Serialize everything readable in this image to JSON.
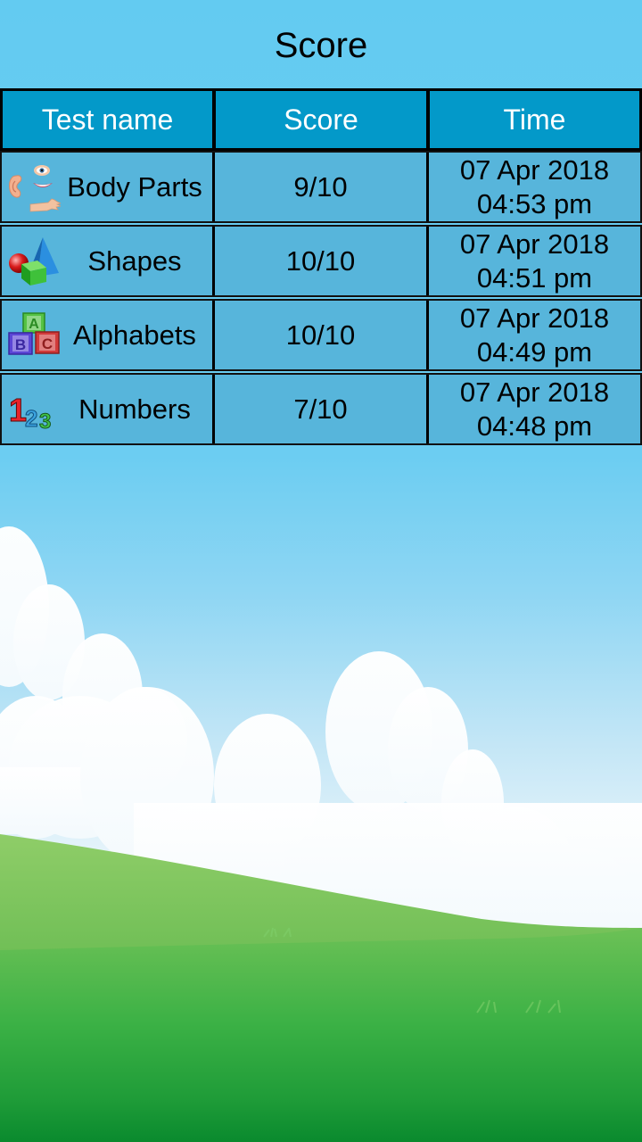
{
  "app_bar": {
    "title": "Score"
  },
  "table": {
    "headers": [
      "Test name",
      "Score",
      "Time"
    ],
    "rows": [
      {
        "icon": "body-parts-icon",
        "name": "Body Parts",
        "score": "9/10",
        "date": "07 Apr 2018",
        "time": "04:53 pm"
      },
      {
        "icon": "shapes-icon",
        "name": "Shapes",
        "score": "10/10",
        "date": "07 Apr 2018",
        "time": "04:51 pm"
      },
      {
        "icon": "alphabet-blocks-icon",
        "name": "Alphabets",
        "score": "10/10",
        "date": "07 Apr 2018",
        "time": "04:49 pm"
      },
      {
        "icon": "numbers-123-icon",
        "name": "Numbers",
        "score": "7/10",
        "date": "07 Apr 2018",
        "time": "04:48 pm"
      }
    ]
  },
  "colors": {
    "app_bar_bg": "#63cbf1",
    "header_bg": "#0399c9",
    "row_bg": "#57b5db",
    "grass": "#2fa83a"
  }
}
